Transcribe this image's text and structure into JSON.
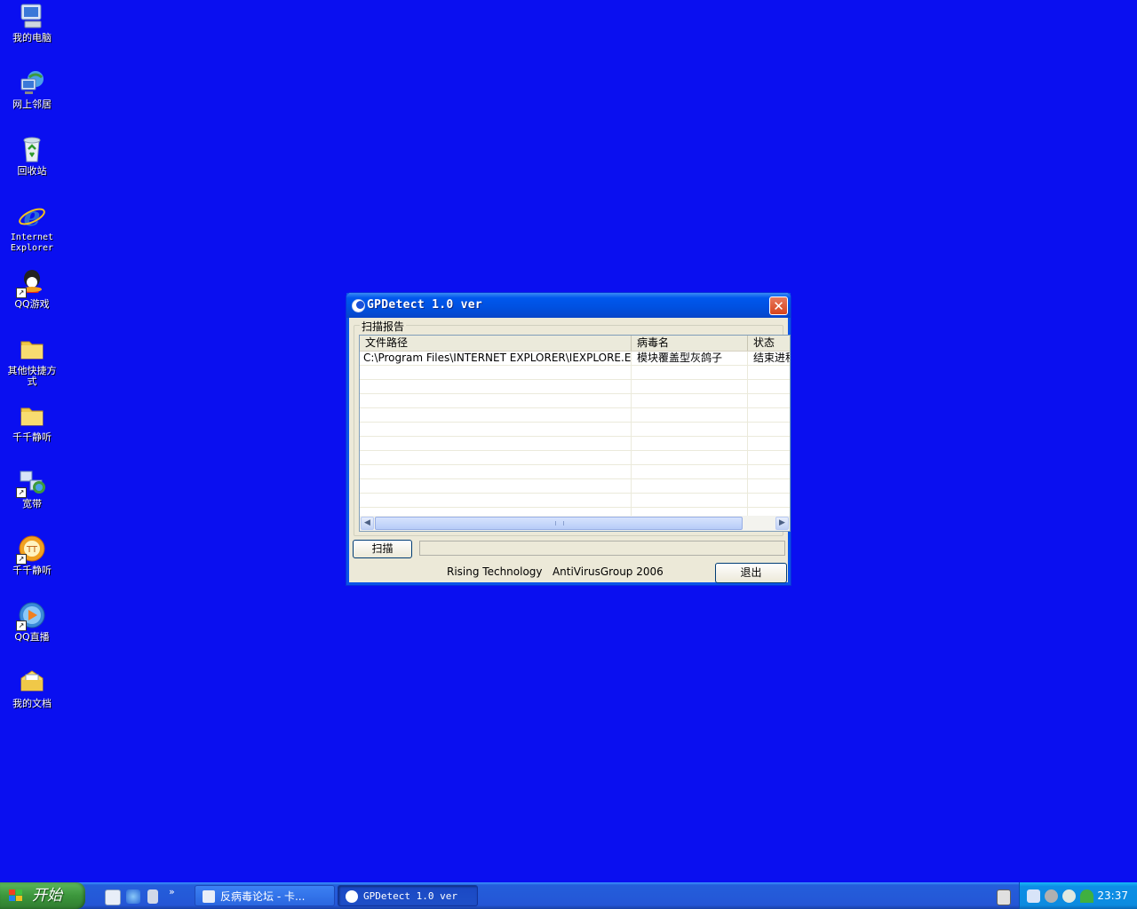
{
  "desktop": {
    "icons": [
      {
        "label": "我的电脑",
        "icon": "my-computer-icon"
      },
      {
        "label": "网上邻居",
        "icon": "network-places-icon"
      },
      {
        "label": "回收站",
        "icon": "recycle-bin-icon"
      },
      {
        "label": "Internet Explorer",
        "icon": "internet-explorer-icon"
      },
      {
        "label": "QQ游戏",
        "icon": "qq-game-icon"
      },
      {
        "label": "其他快捷方式",
        "icon": "folder-icon"
      },
      {
        "label": "千千静听",
        "icon": "folder-icon"
      },
      {
        "label": "宽带",
        "icon": "broadband-icon"
      },
      {
        "label": "千千静听",
        "icon": "ttplayer-icon"
      },
      {
        "label": "QQ直播",
        "icon": "qq-live-icon"
      },
      {
        "label": "我的文档",
        "icon": "my-documents-icon"
      }
    ]
  },
  "window": {
    "title": "GPDetect 1.0 ver",
    "close_label": "✕",
    "group_label": "扫描报告",
    "columns": [
      "文件路径",
      "病毒名",
      "状态"
    ],
    "rows": [
      [
        "C:\\Program Files\\INTERNET EXPLORER\\IEXPLORE.EXE",
        "模块覆盖型灰鸽子",
        "结束进程"
      ]
    ],
    "scan_button": "扫描",
    "exit_button": "退出",
    "footer": "Rising Technology   AntiVirusGroup 2006"
  },
  "taskbar": {
    "start_label": "开始",
    "tasks": [
      {
        "label": "反病毒论坛 - 卡...",
        "active": false
      },
      {
        "label": "GPDetect 1.0 ver",
        "active": true
      }
    ],
    "clock": "23:37"
  },
  "colors": {
    "desktop_bg": "#0a0ff0",
    "titlebar": "#0058ee",
    "window_face": "#ece9d8",
    "taskbar": "#245edb",
    "tray": "#0c8be0"
  }
}
